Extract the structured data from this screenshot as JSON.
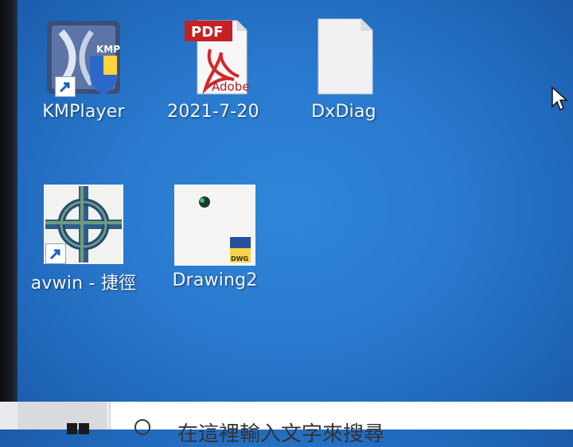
{
  "desktop": {
    "icons": [
      {
        "label": "KMPlayer",
        "icon": "kmplayer-icon",
        "shortcut": true
      },
      {
        "label": "2021-7-20",
        "icon": "pdf-document-icon",
        "shortcut": false
      },
      {
        "label": "DxDiag",
        "icon": "text-document-icon",
        "shortcut": false
      },
      {
        "label": "avwin - 捷徑",
        "icon": "avwin-crosshair-icon",
        "shortcut": true
      },
      {
        "label": "Drawing2",
        "icon": "dwg-drawing-icon",
        "shortcut": false
      }
    ],
    "pdf_badge": "PDF",
    "pdf_brand": "Adobe",
    "km_badge": "KMP",
    "dwg_badge": "DWG"
  },
  "taskbar": {
    "search_placeholder": "在這裡輸入文字來搜尋",
    "start_icon": "windows-logo-icon"
  },
  "colors": {
    "desktop_blue": "#2a7acf",
    "pdf_red": "#d2282a"
  }
}
